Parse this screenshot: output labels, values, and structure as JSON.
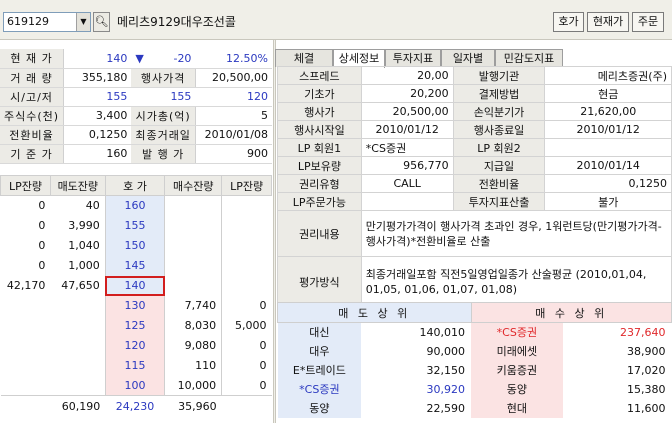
{
  "toolbar": {
    "code": "619129",
    "stock_name": "메리츠9129대우조선콜",
    "btn_quote": "호가",
    "btn_price": "현재가",
    "btn_order": "주문"
  },
  "info": {
    "current_price_label": "현 재 가",
    "current_price": "140",
    "change_arrow": "▼",
    "change": "-20",
    "change_rate": "12.50%",
    "volume_label": "거 래 량",
    "volume": "355,180",
    "strike_label": "행사가격",
    "strike": "20,500,00",
    "ohl_label": "시/고/저",
    "open": "155",
    "high": "155",
    "low": "120",
    "shares_label": "주식수(천)",
    "shares": "3,400",
    "mcap_label": "시가총(억)",
    "mcap": "5",
    "conv_label": "전환비율",
    "conv": "0,1250",
    "last_trade_label": "최종거래일",
    "last_trade": "2010/01/08",
    "base_label": "기 준 가",
    "base": "160",
    "issue_label": "발 행 가",
    "issue": "900"
  },
  "orderbook": {
    "headers": [
      "LP잔량",
      "매도잔량",
      "호 가",
      "매수잔량",
      "LP잔량"
    ],
    "asks": [
      {
        "lp": "0",
        "qty": "40",
        "price": "160"
      },
      {
        "lp": "0",
        "qty": "3,990",
        "price": "155"
      },
      {
        "lp": "0",
        "qty": "1,040",
        "price": "150"
      },
      {
        "lp": "0",
        "qty": "1,000",
        "price": "145"
      },
      {
        "lp": "42,170",
        "qty": "47,650",
        "price": "140"
      }
    ],
    "bids": [
      {
        "price": "130",
        "qty": "7,740",
        "lp": "0"
      },
      {
        "price": "125",
        "qty": "8,030",
        "lp": "5,000"
      },
      {
        "price": "120",
        "qty": "9,080",
        "lp": "0"
      },
      {
        "price": "115",
        "qty": "110",
        "lp": "0"
      },
      {
        "price": "100",
        "qty": "10,000",
        "lp": "0"
      }
    ],
    "total_ask": "60,190",
    "total_diff": "24,230",
    "total_bid": "35,960"
  },
  "tabs": [
    "체결",
    "상세정보",
    "투자지표",
    "일자별",
    "민감도지표"
  ],
  "detail": {
    "rows": [
      {
        "l1": "스프레드",
        "v1": "20,00",
        "l2": "발행기관",
        "v2": "메리츠증권(주)"
      },
      {
        "l1": "기초가",
        "v1": "20,200",
        "l2": "결제방법",
        "v2": "현금"
      },
      {
        "l1": "행사가",
        "v1": "20,500,00",
        "l2": "손익분기가",
        "v2": "21,620,00"
      },
      {
        "l1": "행사시작일",
        "v1": "2010/01/12",
        "l2": "행사종료일",
        "v2": "2010/01/12"
      },
      {
        "l1": "LP 회원1",
        "v1": "*CS증권",
        "l2": "LP 회원2",
        "v2": ""
      },
      {
        "l1": "LP보유량",
        "v1": "956,770",
        "l2": "지급일",
        "v2": "2010/01/14"
      },
      {
        "l1": "권리유형",
        "v1": "CALL",
        "l2": "전환비율",
        "v2": "0,1250"
      },
      {
        "l1": "LP주문가능",
        "v1": "",
        "l2": "투자지표산출",
        "v2": "불가"
      }
    ],
    "rights_label": "권리내용",
    "rights_text": "만기평가가격이 행사가격 초과인 경우, 1워런트당(만기평가가격-행사가격)*전환비율로 산출",
    "eval_label": "평가방식",
    "eval_text": "최종거래일포함 직전5일영업일종가 산술평균 (2010,01,04, 01,05, 01,06, 01,07, 01,08)"
  },
  "brokers": {
    "sell_header": "매 도 상 위",
    "buy_header": "매 수 상 위",
    "rows": [
      {
        "sname": "대신",
        "sval": "140,010",
        "bname": "*CS증권",
        "bval": "237,640"
      },
      {
        "sname": "대우",
        "sval": "90,000",
        "bname": "미래에셋",
        "bval": "38,900"
      },
      {
        "sname": "E*트레이드",
        "sval": "32,150",
        "bname": "키움증권",
        "bval": "17,020"
      },
      {
        "sname": "*CS증권",
        "sval": "30,920",
        "bname": "동양",
        "bval": "15,380"
      },
      {
        "sname": "동양",
        "sval": "22,590",
        "bname": "현대",
        "bval": "11,600"
      }
    ]
  },
  "colors": {
    "up": "#e0282b",
    "down": "#2b39c0",
    "ask_bg": "#e3ebf8",
    "bid_bg": "#fbe3e3"
  }
}
